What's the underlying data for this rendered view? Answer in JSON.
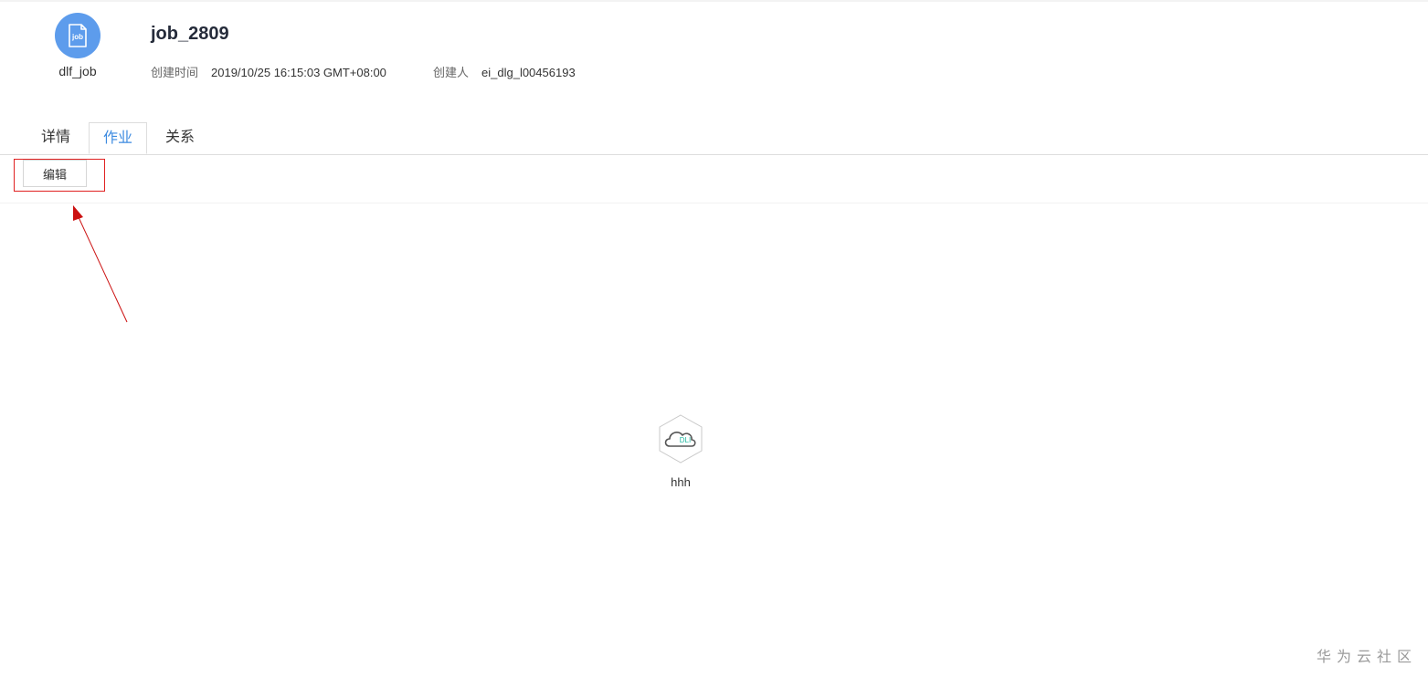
{
  "header": {
    "asset_name": "dlf_job",
    "icon_text": "job",
    "title": "job_2809",
    "created_time_label": "创建时间",
    "created_time_value": "2019/10/25 16:15:03 GMT+08:00",
    "creator_label": "创建人",
    "creator_value": "ei_dlg_l00456193"
  },
  "tabs": [
    {
      "label": "详情",
      "active": false
    },
    {
      "label": "作业",
      "active": true
    },
    {
      "label": "关系",
      "active": false
    }
  ],
  "toolbar": {
    "edit_label": "编辑"
  },
  "canvas": {
    "node": {
      "icon_text": "DLI",
      "label": "hhh"
    }
  },
  "watermark": "华为云社区",
  "colors": {
    "accent": "#3d8be0",
    "icon_bg": "#5d9cec",
    "highlight": "#e02020"
  }
}
